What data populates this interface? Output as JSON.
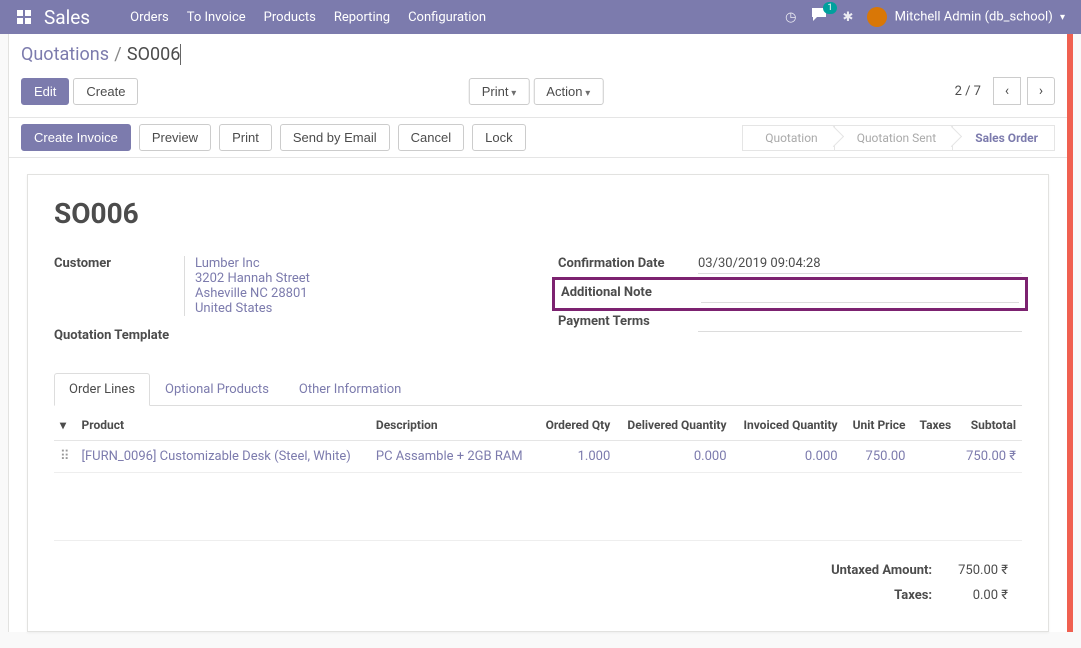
{
  "brand": "Sales",
  "topnav": [
    "Orders",
    "To Invoice",
    "Products",
    "Reporting",
    "Configuration"
  ],
  "topbar": {
    "chat_count": "1",
    "user_label": "Mitchell Admin (db_school)"
  },
  "breadcrumb": {
    "parent": "Quotations",
    "current": "SO006"
  },
  "buttons": {
    "edit": "Edit",
    "create": "Create",
    "print": "Print",
    "action": "Action",
    "create_invoice": "Create Invoice",
    "preview": "Preview",
    "print2": "Print",
    "send_email": "Send by Email",
    "cancel": "Cancel",
    "lock": "Lock"
  },
  "pager": {
    "text": "2 / 7"
  },
  "status_steps": [
    "Quotation",
    "Quotation Sent",
    "Sales Order"
  ],
  "order": {
    "name": "SO006",
    "labels": {
      "customer": "Customer",
      "quotation_template": "Quotation Template",
      "confirmation_date": "Confirmation Date",
      "additional_note": "Additional Note",
      "payment_terms": "Payment Terms"
    },
    "customer": {
      "name": "Lumber Inc",
      "street": "3202 Hannah Street",
      "city": "Asheville NC 28801",
      "country": "United States"
    },
    "confirmation_date": "03/30/2019 09:04:28",
    "additional_note": "",
    "payment_terms": ""
  },
  "tabs": [
    "Order Lines",
    "Optional Products",
    "Other Information"
  ],
  "table": {
    "headers": {
      "product": "Product",
      "description": "Description",
      "ordered": "Ordered Qty",
      "delivered": "Delivered Quantity",
      "invoiced": "Invoiced Quantity",
      "price": "Unit Price",
      "taxes": "Taxes",
      "subtotal": "Subtotal"
    },
    "rows": [
      {
        "product": "[FURN_0096] Customizable Desk (Steel, White)",
        "description": "PC Assamble + 2GB RAM",
        "ordered": "1.000",
        "delivered": "0.000",
        "invoiced": "0.000",
        "price": "750.00",
        "taxes": "",
        "subtotal": "750.00 ₹"
      }
    ]
  },
  "totals": {
    "untaxed_label": "Untaxed Amount:",
    "untaxed_value": "750.00 ₹",
    "taxes_label": "Taxes:",
    "taxes_value": "0.00 ₹"
  }
}
